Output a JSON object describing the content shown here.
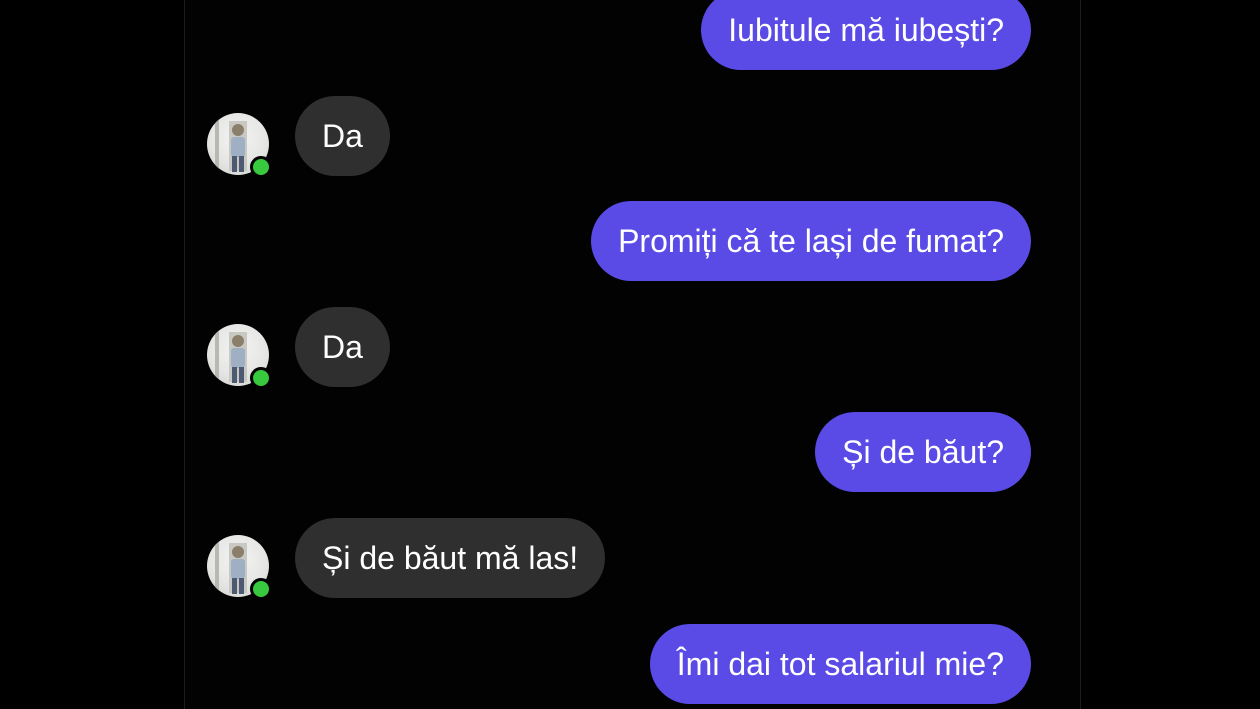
{
  "conversation": {
    "messages": [
      {
        "direction": "out",
        "text": "Iubitule mă iubești?"
      },
      {
        "direction": "in",
        "text": "Da"
      },
      {
        "direction": "out",
        "text": "Promiți că te lași de fumat?"
      },
      {
        "direction": "in",
        "text": "Da"
      },
      {
        "direction": "out",
        "text": "Și de băut?"
      },
      {
        "direction": "in",
        "text": "Și de băut mă las!"
      },
      {
        "direction": "out",
        "text": "Îmi dai tot salariul mie?"
      }
    ]
  },
  "contact": {
    "avatar_icon": "user-avatar-icon",
    "online_status_icon": "online-status-dot-icon",
    "online_color": "#39c93e"
  },
  "colors": {
    "outgoing_bubble": "#5a4be6",
    "incoming_bubble": "#2f2f2f",
    "background": "#000000",
    "text": "#ffffff"
  }
}
